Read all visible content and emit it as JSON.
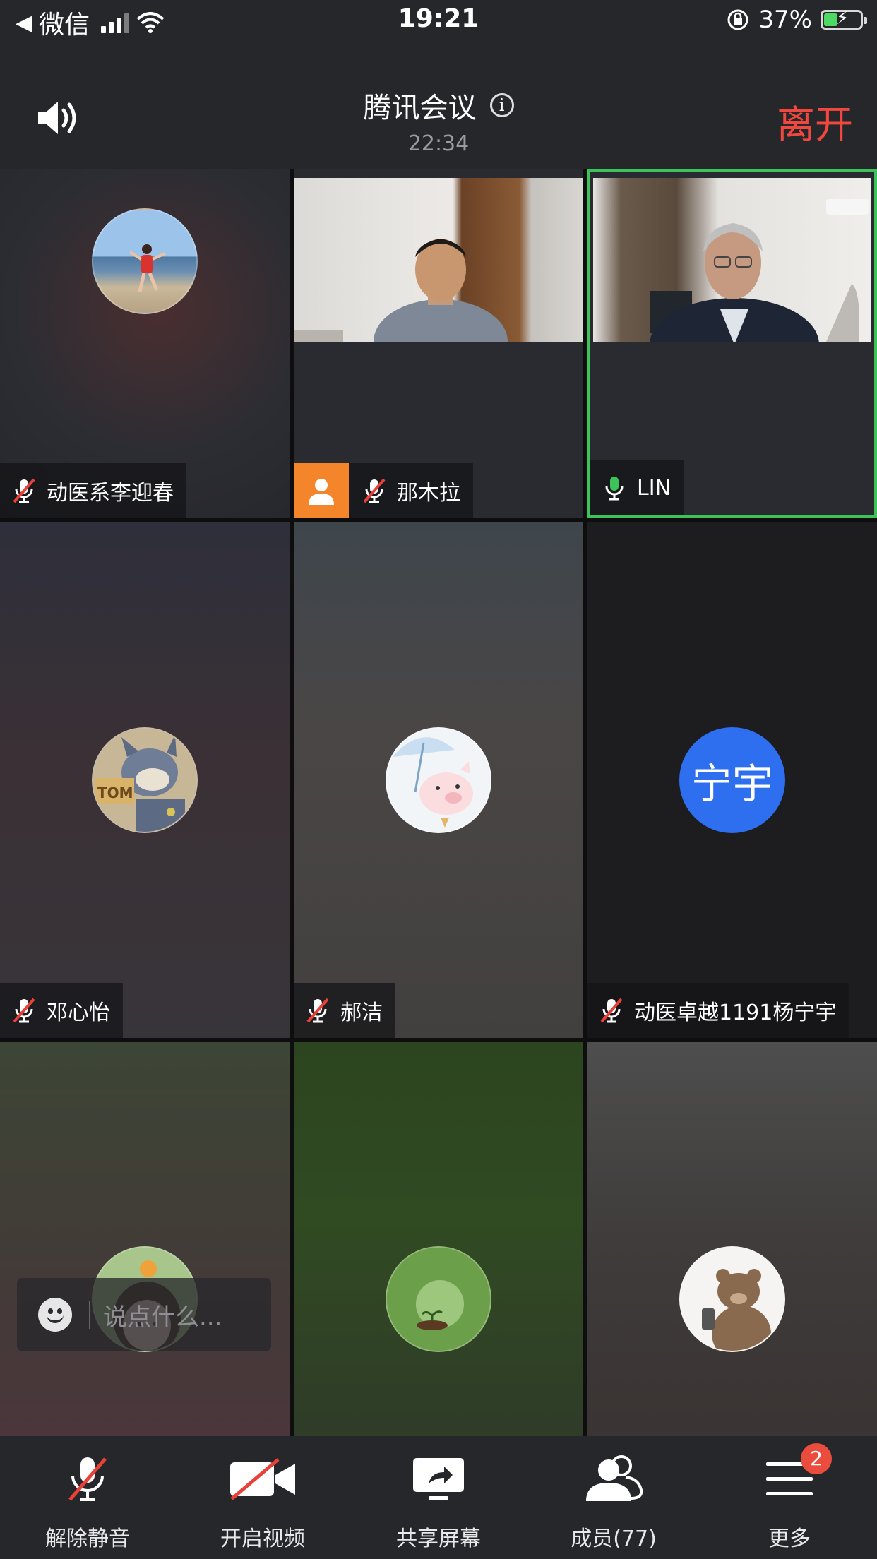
{
  "status_bar": {
    "back_app": "微信",
    "time": "19:21",
    "battery_percent": "37%",
    "battery_level": 0.37
  },
  "header": {
    "title": "腾讯会议",
    "duration": "22:34",
    "leave_label": "离开"
  },
  "participants": [
    {
      "name": "动医系李迎春",
      "mic": "muted",
      "media": "avatar",
      "avatar": "beach-photo-avatar"
    },
    {
      "name": "那木拉",
      "mic": "muted",
      "media": "video",
      "person_badge": true,
      "badge_color": "#f5852b"
    },
    {
      "name": "LIN",
      "mic": "speaking",
      "media": "video",
      "highlight_color": "#3ec35a"
    },
    {
      "name": "邓心怡",
      "mic": "muted",
      "media": "avatar",
      "avatar": "cartoon-cat-avatar"
    },
    {
      "name": "郝洁",
      "mic": "muted",
      "media": "avatar",
      "avatar": "pig-umbrella-avatar"
    },
    {
      "name": "动医卓越1191杨宁宇",
      "mic": "muted",
      "media": "initials",
      "initials": "宁宇",
      "initials_color": "#2d6fef"
    },
    {
      "name": "",
      "media": "avatar",
      "avatar": "girl-cartoon-avatar"
    },
    {
      "name": "",
      "media": "avatar",
      "avatar": "sprout-avatar"
    },
    {
      "name": "",
      "media": "avatar",
      "avatar": "bear-avatar"
    }
  ],
  "chat": {
    "placeholder": "说点什么..."
  },
  "toolbar": {
    "items": [
      {
        "label": "解除静音",
        "icon": "mic-off-icon"
      },
      {
        "label": "开启视频",
        "icon": "video-off-icon"
      },
      {
        "label": "共享屏幕",
        "icon": "share-screen-icon"
      },
      {
        "label": "成员(77)",
        "icon": "members-icon"
      },
      {
        "label": "更多",
        "icon": "menu-icon",
        "badge": "2"
      }
    ]
  },
  "colors": {
    "leave": "#f0483e",
    "muted_slash": "#e8413a",
    "mic_active": "#3ec35a",
    "badge": "#ea4d3d"
  }
}
